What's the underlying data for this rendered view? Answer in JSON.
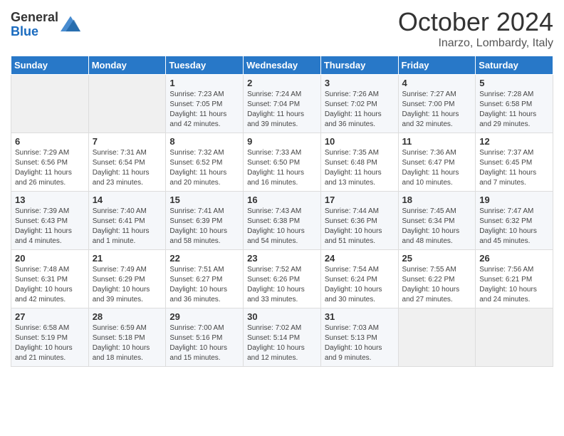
{
  "header": {
    "logo": {
      "general": "General",
      "blue": "Blue"
    },
    "title": "October 2024",
    "location": "Inarzo, Lombardy, Italy"
  },
  "days_of_week": [
    "Sunday",
    "Monday",
    "Tuesday",
    "Wednesday",
    "Thursday",
    "Friday",
    "Saturday"
  ],
  "weeks": [
    [
      {
        "day": "",
        "sunrise": "",
        "sunset": "",
        "daylight": ""
      },
      {
        "day": "",
        "sunrise": "",
        "sunset": "",
        "daylight": ""
      },
      {
        "day": "1",
        "sunrise": "Sunrise: 7:23 AM",
        "sunset": "Sunset: 7:05 PM",
        "daylight": "Daylight: 11 hours and 42 minutes."
      },
      {
        "day": "2",
        "sunrise": "Sunrise: 7:24 AM",
        "sunset": "Sunset: 7:04 PM",
        "daylight": "Daylight: 11 hours and 39 minutes."
      },
      {
        "day": "3",
        "sunrise": "Sunrise: 7:26 AM",
        "sunset": "Sunset: 7:02 PM",
        "daylight": "Daylight: 11 hours and 36 minutes."
      },
      {
        "day": "4",
        "sunrise": "Sunrise: 7:27 AM",
        "sunset": "Sunset: 7:00 PM",
        "daylight": "Daylight: 11 hours and 32 minutes."
      },
      {
        "day": "5",
        "sunrise": "Sunrise: 7:28 AM",
        "sunset": "Sunset: 6:58 PM",
        "daylight": "Daylight: 11 hours and 29 minutes."
      }
    ],
    [
      {
        "day": "6",
        "sunrise": "Sunrise: 7:29 AM",
        "sunset": "Sunset: 6:56 PM",
        "daylight": "Daylight: 11 hours and 26 minutes."
      },
      {
        "day": "7",
        "sunrise": "Sunrise: 7:31 AM",
        "sunset": "Sunset: 6:54 PM",
        "daylight": "Daylight: 11 hours and 23 minutes."
      },
      {
        "day": "8",
        "sunrise": "Sunrise: 7:32 AM",
        "sunset": "Sunset: 6:52 PM",
        "daylight": "Daylight: 11 hours and 20 minutes."
      },
      {
        "day": "9",
        "sunrise": "Sunrise: 7:33 AM",
        "sunset": "Sunset: 6:50 PM",
        "daylight": "Daylight: 11 hours and 16 minutes."
      },
      {
        "day": "10",
        "sunrise": "Sunrise: 7:35 AM",
        "sunset": "Sunset: 6:48 PM",
        "daylight": "Daylight: 11 hours and 13 minutes."
      },
      {
        "day": "11",
        "sunrise": "Sunrise: 7:36 AM",
        "sunset": "Sunset: 6:47 PM",
        "daylight": "Daylight: 11 hours and 10 minutes."
      },
      {
        "day": "12",
        "sunrise": "Sunrise: 7:37 AM",
        "sunset": "Sunset: 6:45 PM",
        "daylight": "Daylight: 11 hours and 7 minutes."
      }
    ],
    [
      {
        "day": "13",
        "sunrise": "Sunrise: 7:39 AM",
        "sunset": "Sunset: 6:43 PM",
        "daylight": "Daylight: 11 hours and 4 minutes."
      },
      {
        "day": "14",
        "sunrise": "Sunrise: 7:40 AM",
        "sunset": "Sunset: 6:41 PM",
        "daylight": "Daylight: 11 hours and 1 minute."
      },
      {
        "day": "15",
        "sunrise": "Sunrise: 7:41 AM",
        "sunset": "Sunset: 6:39 PM",
        "daylight": "Daylight: 10 hours and 58 minutes."
      },
      {
        "day": "16",
        "sunrise": "Sunrise: 7:43 AM",
        "sunset": "Sunset: 6:38 PM",
        "daylight": "Daylight: 10 hours and 54 minutes."
      },
      {
        "day": "17",
        "sunrise": "Sunrise: 7:44 AM",
        "sunset": "Sunset: 6:36 PM",
        "daylight": "Daylight: 10 hours and 51 minutes."
      },
      {
        "day": "18",
        "sunrise": "Sunrise: 7:45 AM",
        "sunset": "Sunset: 6:34 PM",
        "daylight": "Daylight: 10 hours and 48 minutes."
      },
      {
        "day": "19",
        "sunrise": "Sunrise: 7:47 AM",
        "sunset": "Sunset: 6:32 PM",
        "daylight": "Daylight: 10 hours and 45 minutes."
      }
    ],
    [
      {
        "day": "20",
        "sunrise": "Sunrise: 7:48 AM",
        "sunset": "Sunset: 6:31 PM",
        "daylight": "Daylight: 10 hours and 42 minutes."
      },
      {
        "day": "21",
        "sunrise": "Sunrise: 7:49 AM",
        "sunset": "Sunset: 6:29 PM",
        "daylight": "Daylight: 10 hours and 39 minutes."
      },
      {
        "day": "22",
        "sunrise": "Sunrise: 7:51 AM",
        "sunset": "Sunset: 6:27 PM",
        "daylight": "Daylight: 10 hours and 36 minutes."
      },
      {
        "day": "23",
        "sunrise": "Sunrise: 7:52 AM",
        "sunset": "Sunset: 6:26 PM",
        "daylight": "Daylight: 10 hours and 33 minutes."
      },
      {
        "day": "24",
        "sunrise": "Sunrise: 7:54 AM",
        "sunset": "Sunset: 6:24 PM",
        "daylight": "Daylight: 10 hours and 30 minutes."
      },
      {
        "day": "25",
        "sunrise": "Sunrise: 7:55 AM",
        "sunset": "Sunset: 6:22 PM",
        "daylight": "Daylight: 10 hours and 27 minutes."
      },
      {
        "day": "26",
        "sunrise": "Sunrise: 7:56 AM",
        "sunset": "Sunset: 6:21 PM",
        "daylight": "Daylight: 10 hours and 24 minutes."
      }
    ],
    [
      {
        "day": "27",
        "sunrise": "Sunrise: 6:58 AM",
        "sunset": "Sunset: 5:19 PM",
        "daylight": "Daylight: 10 hours and 21 minutes."
      },
      {
        "day": "28",
        "sunrise": "Sunrise: 6:59 AM",
        "sunset": "Sunset: 5:18 PM",
        "daylight": "Daylight: 10 hours and 18 minutes."
      },
      {
        "day": "29",
        "sunrise": "Sunrise: 7:00 AM",
        "sunset": "Sunset: 5:16 PM",
        "daylight": "Daylight: 10 hours and 15 minutes."
      },
      {
        "day": "30",
        "sunrise": "Sunrise: 7:02 AM",
        "sunset": "Sunset: 5:14 PM",
        "daylight": "Daylight: 10 hours and 12 minutes."
      },
      {
        "day": "31",
        "sunrise": "Sunrise: 7:03 AM",
        "sunset": "Sunset: 5:13 PM",
        "daylight": "Daylight: 10 hours and 9 minutes."
      },
      {
        "day": "",
        "sunrise": "",
        "sunset": "",
        "daylight": ""
      },
      {
        "day": "",
        "sunrise": "",
        "sunset": "",
        "daylight": ""
      }
    ]
  ]
}
